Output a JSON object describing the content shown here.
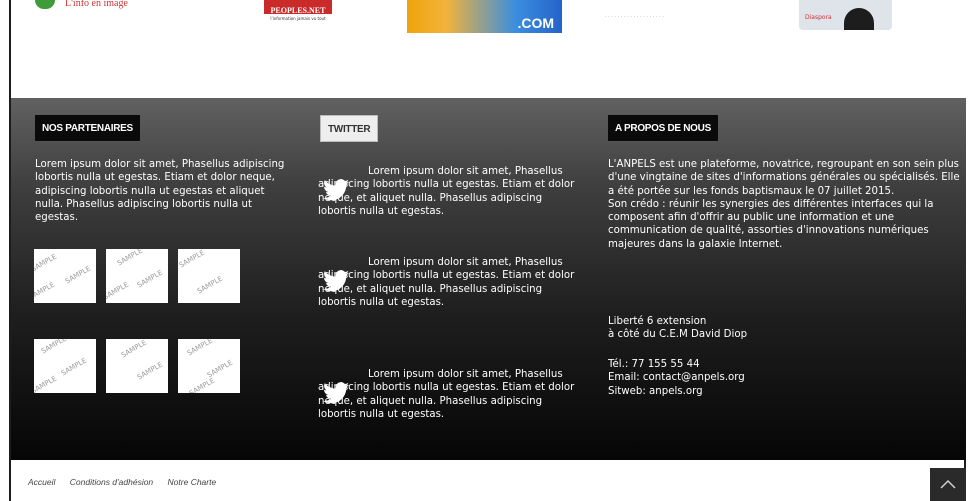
{
  "logos": {
    "logo1_tagline": "L'info en image",
    "logo2_name": "PEOPLES.NET",
    "logo2_sub": "l'information jamais vu tout",
    "logo3_suffix": ".COM",
    "logo5_text": "Diaspora"
  },
  "partners": {
    "heading": "NOS PARTENAIRES",
    "text": "Lorem ipsum dolor sit amet, Phasellus adipiscing lobortis nulla ut egestas. Etiam et dolor neque, adipiscing lobortis nulla ut egestas et aliquet nulla. Phasellus adipiscing lobortis nulla ut egestas.",
    "thumb_label": "SAMPLE"
  },
  "twitter": {
    "heading": "TWITTER",
    "tweets": [
      {
        "text": "Lorem ipsum dolor sit amet, Phasellus adipiscing lobortis nulla ut egestas. Etiam et dolor neque, et aliquet nulla. Phasellus adipiscing lobortis nulla ut egestas."
      },
      {
        "text": "Lorem ipsum dolor sit amet, Phasellus adipiscing lobortis nulla ut egestas. Etiam et dolor neque, et aliquet nulla. Phasellus adipiscing lobortis nulla ut egestas."
      },
      {
        "text": "Lorem ipsum dolor sit amet, Phasellus adipiscing lobortis nulla ut egestas. Etiam et dolor neque, et aliquet nulla. Phasellus adipiscing lobortis nulla ut egestas."
      }
    ]
  },
  "about": {
    "heading": "A PROPOS DE NOUS",
    "paragraph1": "L'ANPELS est une plateforme, novatrice, regroupant en son sein plus d'une vingtaine de sites d'informations générales ou spécialisés. Elle a été portée sur les fonds baptismaux le 07 juillet 2015.",
    "paragraph2": "Son crédo : réunir les synergies des différentes interfaces qui la composent afin d'offrir au public une information et une communication de qualité, assorties d'innovations numériques majeures dans la galaxie Internet.",
    "address_line1": "Liberté 6 extension",
    "address_line2": "à côté du C.E.M David Diop",
    "phone": "Tél.: 77 155 55 44",
    "email": "Email: contact@anpels.org",
    "website": "Sitweb: anpels.org"
  },
  "bottom_nav": {
    "items": [
      "Accueil",
      "Conditions d'adhésion",
      "Notre Charte"
    ]
  },
  "colors": {
    "footer_top": "#616161",
    "footer_bottom": "#060606",
    "text": "#ffffff",
    "heading_dark": "#0a0a0a",
    "heading_light": "#eeeeee"
  },
  "icons": {
    "tweet_icon": "twitter-bird-icon",
    "scroll_top_icon": "chevron-up-icon"
  }
}
